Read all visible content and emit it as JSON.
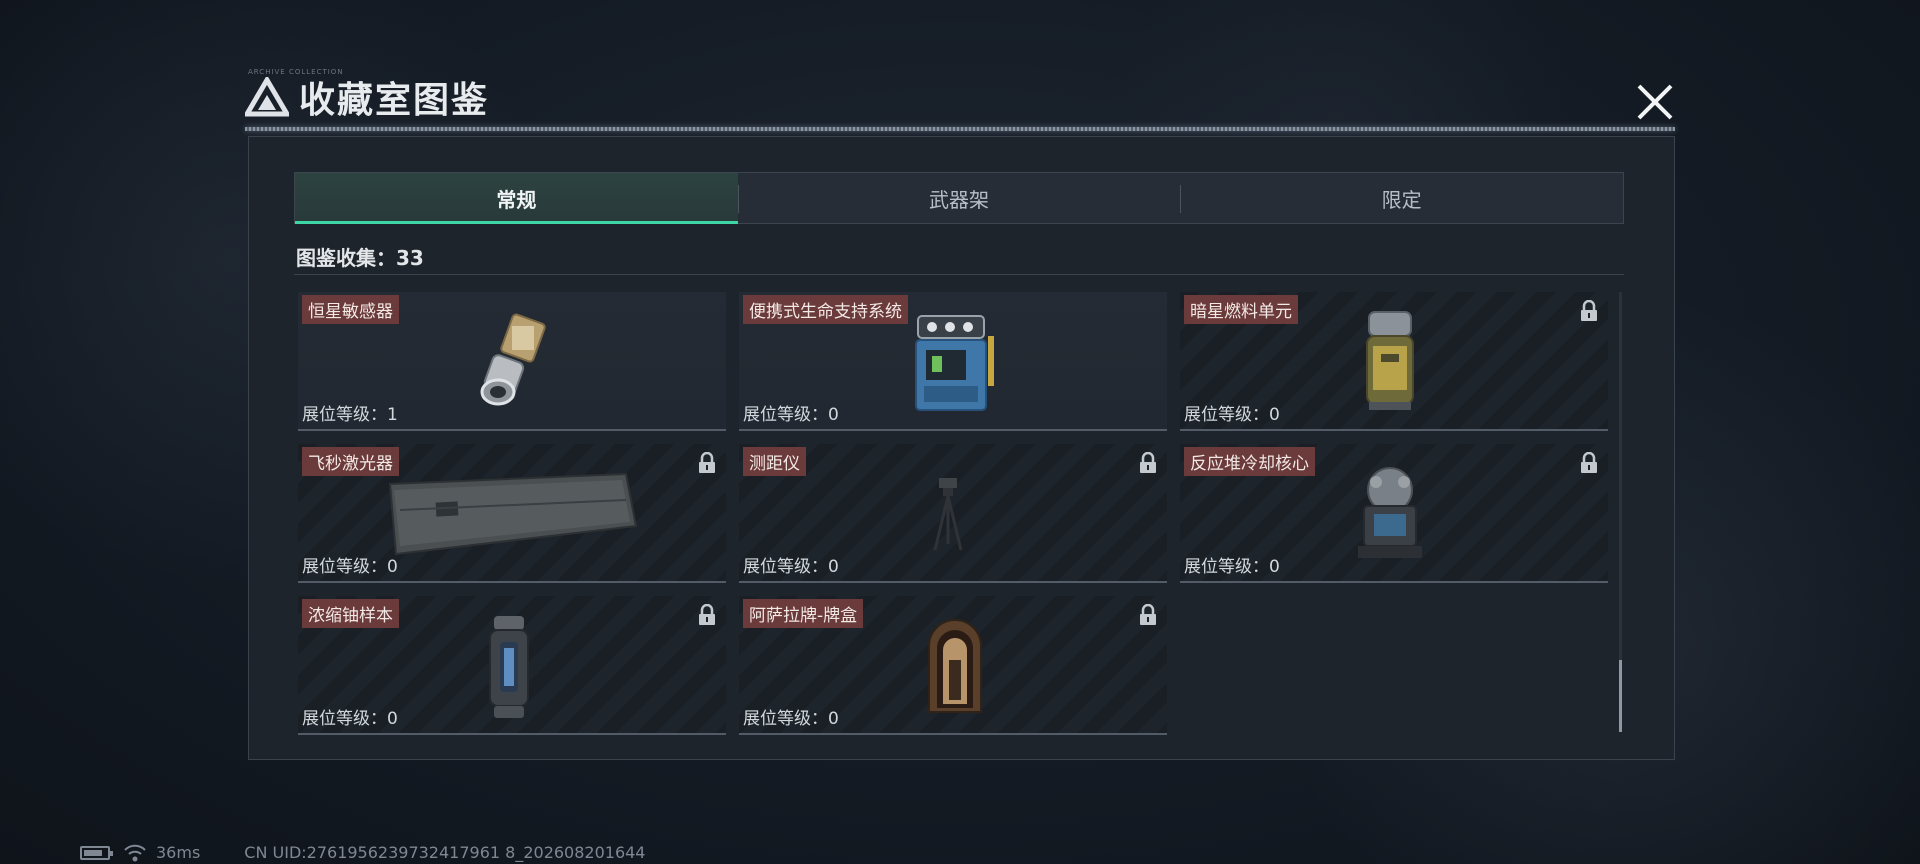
{
  "header": {
    "title": "收藏室图鉴",
    "subtitle": "ARCHIVE COLLECTION",
    "close_icon": "close-icon"
  },
  "tabs": [
    {
      "label": "常规",
      "active": true
    },
    {
      "label": "武器架",
      "active": false
    },
    {
      "label": "限定",
      "active": false
    }
  ],
  "collection": {
    "text": "图鉴收集：33"
  },
  "items": [
    {
      "name": "恒星敏感器",
      "level": "展位等级：1",
      "locked": false,
      "icon": "star-sensor-icon"
    },
    {
      "name": "便携式生命支持系统",
      "level": "展位等级：0",
      "locked": false,
      "icon": "life-support-icon"
    },
    {
      "name": "暗星燃料单元",
      "level": "展位等级：0",
      "locked": true,
      "icon": "fuel-cell-icon"
    },
    {
      "name": "飞秒激光器",
      "level": "展位等级：0",
      "locked": true,
      "icon": "laser-case-icon"
    },
    {
      "name": "测距仪",
      "level": "展位等级：0",
      "locked": true,
      "icon": "rangefinder-icon"
    },
    {
      "name": "反应堆冷却核心",
      "level": "展位等级：0",
      "locked": true,
      "icon": "reactor-core-icon"
    },
    {
      "name": "浓缩铀样本",
      "level": "展位等级：0",
      "locked": true,
      "icon": "uranium-canister-icon"
    },
    {
      "name": "阿萨拉牌-牌盒",
      "level": "展位等级：0",
      "locked": true,
      "icon": "card-box-icon"
    }
  ],
  "status": {
    "ping": "36ms",
    "uid": "CN UID:2761956239732417961 8_202608201644"
  },
  "colors": {
    "accent": "#3fd6a6",
    "name_tag": "#6b3a3a"
  }
}
